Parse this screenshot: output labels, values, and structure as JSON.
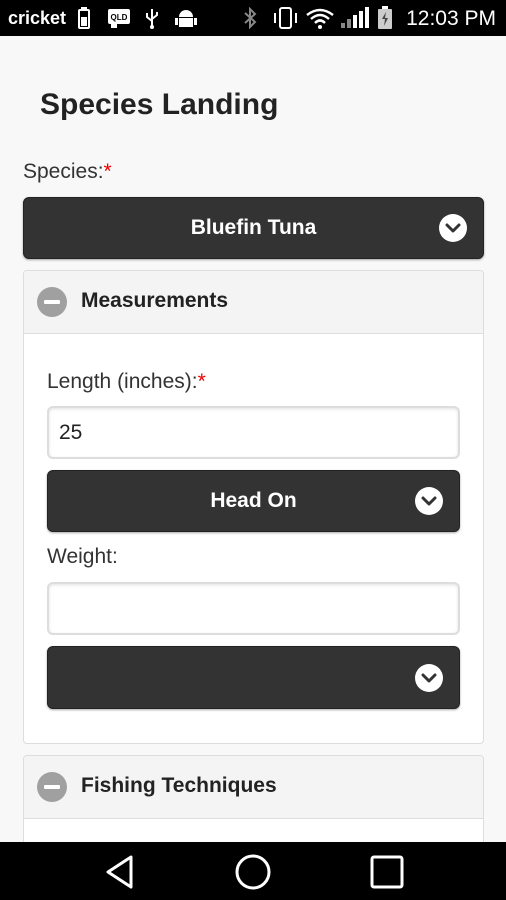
{
  "status_bar": {
    "carrier": "cricket",
    "time": "12:03 PM",
    "icons": [
      "battery-small-icon",
      "qld-notification-icon",
      "usb-icon",
      "android-debug-icon",
      "bluetooth-icon",
      "vibrate-icon",
      "wifi-icon",
      "signal-icon",
      "battery-icon"
    ]
  },
  "page": {
    "title": "Species Landing"
  },
  "species": {
    "label": "Species:",
    "required_mark": "*",
    "selected": "Bluefin Tuna"
  },
  "measurements": {
    "title": "Measurements",
    "length_label": "Length (inches):",
    "required_mark": "*",
    "length_value": "25",
    "length_type_selected": "Head On",
    "weight_label": "Weight:",
    "weight_value": "",
    "weight_unit_selected": ""
  },
  "fishing_techniques": {
    "title": "Fishing Techniques"
  },
  "colors": {
    "select_bg": "#333333",
    "required": "#ee0000",
    "panel_head": "#f4f4f4"
  }
}
